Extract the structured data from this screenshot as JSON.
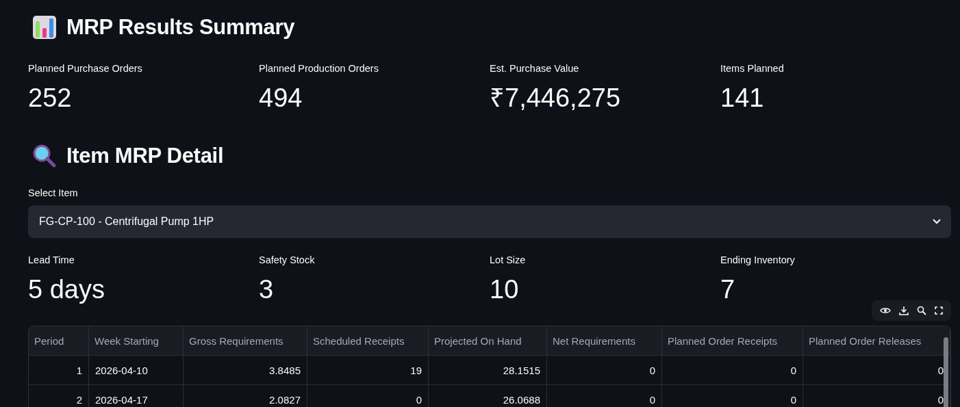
{
  "summary": {
    "title": "MRP Results Summary",
    "metrics": [
      {
        "label": "Planned Purchase Orders",
        "value": "252"
      },
      {
        "label": "Planned Production Orders",
        "value": "494"
      },
      {
        "label": "Est. Purchase Value",
        "value": "₹7,446,275"
      },
      {
        "label": "Items Planned",
        "value": "141"
      }
    ]
  },
  "detail": {
    "title": "Item MRP Detail",
    "select": {
      "label": "Select Item",
      "value": "FG-CP-100 - Centrifugal Pump 1HP"
    },
    "metrics": [
      {
        "label": "Lead Time",
        "value": "5 days"
      },
      {
        "label": "Safety Stock",
        "value": "3"
      },
      {
        "label": "Lot Size",
        "value": "10"
      },
      {
        "label": "Ending Inventory",
        "value": "7"
      }
    ],
    "table": {
      "columns": [
        {
          "label": "Period",
          "kind": "number"
        },
        {
          "label": "Week Starting",
          "kind": "text"
        },
        {
          "label": "Gross Requirements",
          "kind": "number"
        },
        {
          "label": "Scheduled Receipts",
          "kind": "number"
        },
        {
          "label": "Projected On Hand",
          "kind": "number"
        },
        {
          "label": "Net Requirements",
          "kind": "number"
        },
        {
          "label": "Planned Order Receipts",
          "kind": "number"
        },
        {
          "label": "Planned Order Releases",
          "kind": "number"
        }
      ],
      "rows": [
        [
          "1",
          "2026-04-10",
          "3.8485",
          "19",
          "28.1515",
          "0",
          "0",
          "0"
        ],
        [
          "2",
          "2026-04-17",
          "2.0827",
          "0",
          "26.0688",
          "0",
          "0",
          "0"
        ]
      ]
    }
  }
}
